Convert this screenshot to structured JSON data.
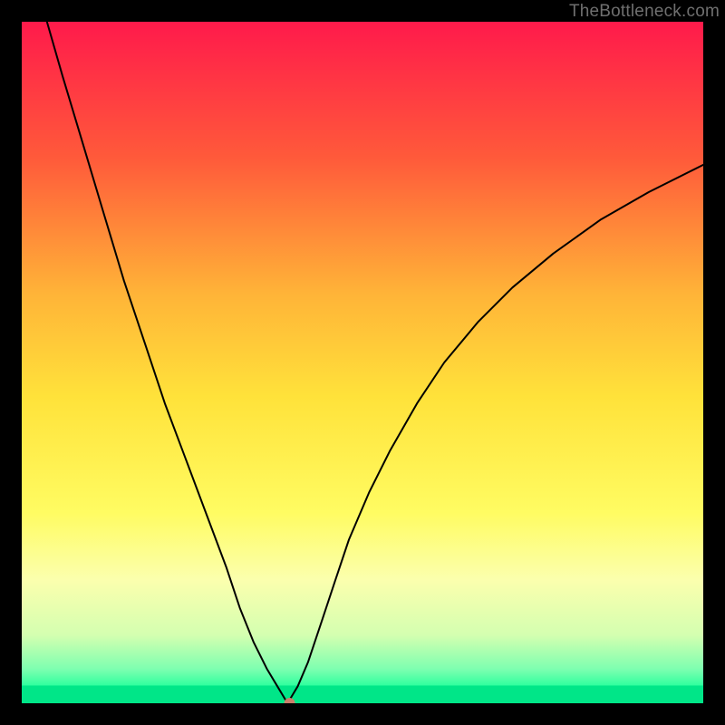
{
  "watermark": "TheBottleneck.com",
  "chart_data": {
    "type": "line",
    "title": "",
    "xlabel": "",
    "ylabel": "",
    "xlim": [
      0,
      100
    ],
    "ylim": [
      0,
      100
    ],
    "grid": false,
    "legend": false,
    "background_gradient_stops": [
      {
        "offset": 0.0,
        "color": "#ff1a4b"
      },
      {
        "offset": 0.2,
        "color": "#ff5a3a"
      },
      {
        "offset": 0.4,
        "color": "#ffb438"
      },
      {
        "offset": 0.55,
        "color": "#ffe23a"
      },
      {
        "offset": 0.72,
        "color": "#fffc62"
      },
      {
        "offset": 0.82,
        "color": "#fbffae"
      },
      {
        "offset": 0.9,
        "color": "#d4ffb0"
      },
      {
        "offset": 0.95,
        "color": "#7dffb0"
      },
      {
        "offset": 0.975,
        "color": "#2dff9e"
      },
      {
        "offset": 1.0,
        "color": "#00e688"
      }
    ],
    "series": [
      {
        "name": "bottleneck-curve",
        "stroke": "#000000",
        "stroke_width": 2,
        "x": [
          3.7,
          6,
          9,
          12,
          15,
          18,
          21,
          24,
          27,
          30,
          32,
          34,
          36,
          37.5,
          39,
          40.5,
          42,
          44,
          46,
          48,
          51,
          54,
          58,
          62,
          67,
          72,
          78,
          85,
          92,
          100
        ],
        "y": [
          100,
          92,
          82,
          72,
          62,
          53,
          44,
          36,
          28,
          20,
          14,
          9,
          5,
          2.5,
          0,
          2.5,
          6,
          12,
          18,
          24,
          31,
          37,
          44,
          50,
          56,
          61,
          66,
          71,
          75,
          79
        ]
      }
    ],
    "marker": {
      "x": 39.3,
      "y": 0,
      "r": 6,
      "color": "#c97f6a"
    },
    "green_strip": {
      "y": 97.4,
      "height": 2.6,
      "color": "#00e688"
    }
  }
}
